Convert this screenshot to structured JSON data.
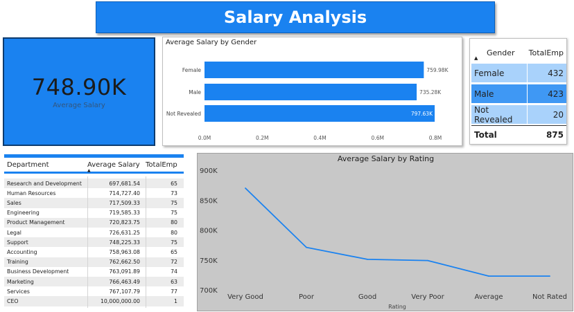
{
  "header": {
    "title": "Salary Analysis"
  },
  "kpi": {
    "value": "748.90K",
    "label": "Average Salary"
  },
  "colors": {
    "accent": "#1a82f0",
    "line": "#1a82f0",
    "chart_bg": "#c8c8c8"
  },
  "gender_table": {
    "headers": [
      "Gender",
      "TotalEmp"
    ],
    "rows": [
      {
        "gender": "Female",
        "total": "432"
      },
      {
        "gender": "Male",
        "total": "423"
      },
      {
        "gender": "Not Revealed",
        "total": "20"
      }
    ],
    "total_label": "Total",
    "total_value": "875"
  },
  "dept_table": {
    "headers": [
      "Department",
      "Average Salary",
      "TotalEmp"
    ],
    "rows": [
      {
        "dept": "Research and Development",
        "avg": "697,681.54",
        "emp": "65"
      },
      {
        "dept": "Human Resources",
        "avg": "714,727.40",
        "emp": "73"
      },
      {
        "dept": "Sales",
        "avg": "717,509.33",
        "emp": "75"
      },
      {
        "dept": "Engineering",
        "avg": "719,585.33",
        "emp": "75"
      },
      {
        "dept": "Product Management",
        "avg": "720,823.75",
        "emp": "80"
      },
      {
        "dept": "Legal",
        "avg": "726,631.25",
        "emp": "80"
      },
      {
        "dept": "Support",
        "avg": "748,225.33",
        "emp": "75"
      },
      {
        "dept": "Accounting",
        "avg": "758,963.08",
        "emp": "65"
      },
      {
        "dept": "Training",
        "avg": "762,662.50",
        "emp": "72"
      },
      {
        "dept": "Business Development",
        "avg": "763,091.89",
        "emp": "74"
      },
      {
        "dept": "Marketing",
        "avg": "766,463.49",
        "emp": "63"
      },
      {
        "dept": "Services",
        "avg": "767,107.79",
        "emp": "77"
      },
      {
        "dept": "CEO",
        "avg": "10,000,000.00",
        "emp": "1"
      }
    ]
  },
  "chart_data": [
    {
      "type": "bar",
      "orientation": "horizontal",
      "title": "Average Salary by Gender",
      "categories": [
        "Female",
        "Male",
        "Not Revealed"
      ],
      "values": [
        759980,
        735280,
        797630
      ],
      "data_labels": [
        "759.98K",
        "735.28K",
        "797.63K"
      ],
      "xticks": [
        "0.0M",
        "0.2M",
        "0.4M",
        "0.6M",
        "0.8M"
      ],
      "xlim": [
        0,
        800000
      ],
      "grid": false
    },
    {
      "type": "line",
      "title": "Average Salary by Rating",
      "xlabel": "Rating",
      "categories": [
        "Very Good",
        "Poor",
        "Good",
        "Very Poor",
        "Average",
        "Not Rated"
      ],
      "values": [
        870000,
        771000,
        751000,
        749000,
        723000,
        723000
      ],
      "yticks": [
        "900K",
        "850K",
        "800K",
        "750K",
        "700K"
      ],
      "ylim": [
        700000,
        900000
      ],
      "grid": false
    }
  ]
}
